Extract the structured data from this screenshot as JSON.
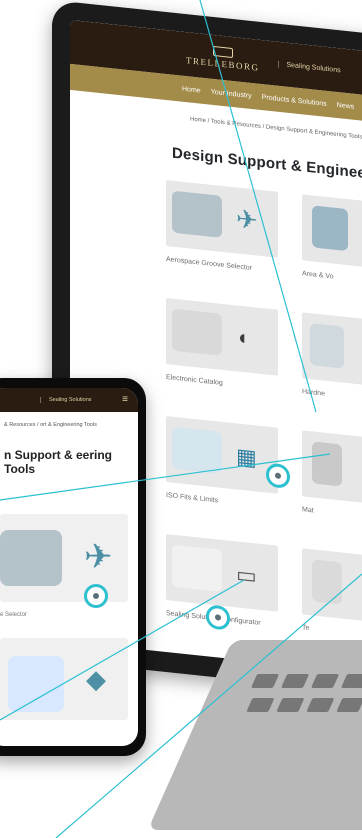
{
  "laptop": {
    "brand": "TRELLEBORG",
    "sub": "Sealing Solutions",
    "nav": [
      "Home",
      "Your Industry",
      "Products & Solutions",
      "News"
    ],
    "breadcrumb": "Home / Tools & Resources / Design Support & Engineering Tools",
    "title": "Design Support & Enginee",
    "cards": [
      {
        "label": "Aerospace Groove Selector"
      },
      {
        "label": "Area & Vo"
      },
      {
        "label": "Electronic Catalog"
      },
      {
        "label": "Hardne"
      },
      {
        "label": "ISO Fits & Limits"
      },
      {
        "label": "Mat"
      },
      {
        "label": "Sealing Solutions Configurator"
      },
      {
        "label": "Te"
      }
    ]
  },
  "phone": {
    "sub": "Sealing Solutions",
    "breadcrumb": "& Resources / ort & Engineering Tools",
    "title": "n Support & eering Tools",
    "card1_caption": "e Selector"
  },
  "colors": {
    "accent": "#2cc0d1",
    "header": "#2a1c10",
    "nav": "#a38b4a"
  }
}
